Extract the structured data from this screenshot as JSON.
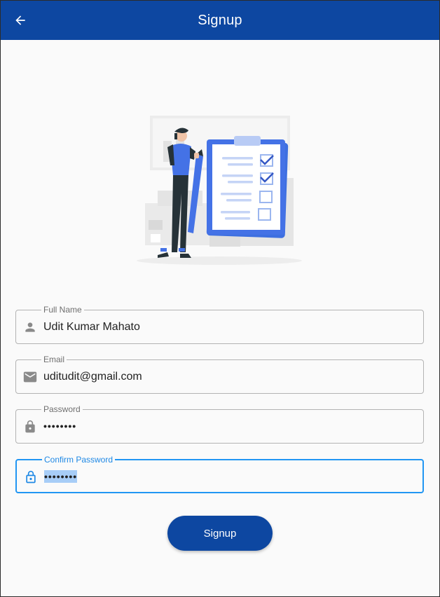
{
  "appbar": {
    "title": "Signup",
    "back_icon": "arrow-left-icon",
    "color": "#0d47a1"
  },
  "illustration": {
    "name": "signup-checklist-illustration"
  },
  "form": {
    "full_name": {
      "label": "Full Name",
      "value": "Udit Kumar Mahato",
      "icon": "person-icon"
    },
    "email": {
      "label": "Email",
      "value": "uditudit@gmail.com",
      "icon": "mail-icon"
    },
    "password": {
      "label": "Password",
      "value": "••••••••",
      "icon": "lock-icon"
    },
    "confirm_password": {
      "label": "Confirm Password",
      "value": "••••••••",
      "icon": "lock-icon",
      "focused": true
    }
  },
  "signup_button": {
    "label": "Signup",
    "color": "#0d47a1"
  },
  "accent_color": "#2196f3"
}
